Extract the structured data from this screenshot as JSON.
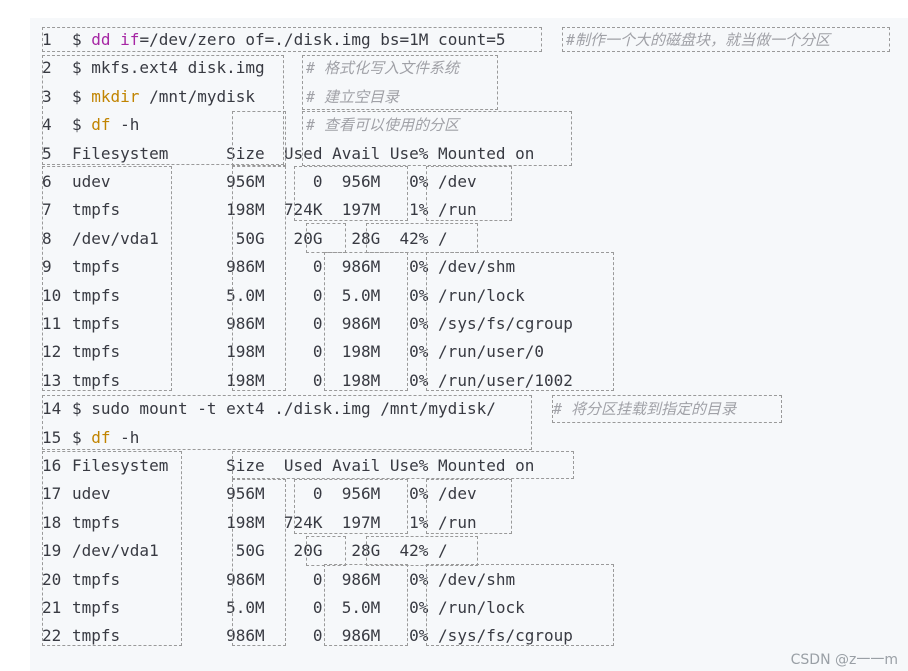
{
  "lines": [
    {
      "n": "1",
      "parts": [
        [
          "op",
          "$ "
        ],
        [
          "kw",
          "dd"
        ],
        [
          "op",
          " "
        ],
        [
          "kw",
          "if"
        ],
        [
          "op",
          "=/dev/zero of=./disk.img bs=1M count=5"
        ]
      ],
      "comment": "#制作一个大的磁盘块，就当做一个分区"
    },
    {
      "n": "2",
      "parts": [
        [
          "op",
          "$ mkfs.ext4 disk.img"
        ]
      ],
      "comment": "# 格式化写入文件系统"
    },
    {
      "n": "3",
      "parts": [
        [
          "op",
          "$ "
        ],
        [
          "fn",
          "mkdir"
        ],
        [
          "op",
          " /mnt/mydisk"
        ]
      ],
      "comment": "# 建立空目录"
    },
    {
      "n": "4",
      "parts": [
        [
          "op",
          "$ "
        ],
        [
          "fn",
          "df"
        ],
        [
          "op",
          " -h"
        ]
      ],
      "comment": "# 查看可以使用的分区"
    },
    {
      "n": "5",
      "parts": [
        [
          "op",
          "Filesystem      Size  Used Avail Use% Mounted on"
        ]
      ],
      "comment": ""
    },
    {
      "n": "6",
      "parts": [
        [
          "op",
          "udev            956M     0  956M   0% /dev"
        ]
      ],
      "comment": ""
    },
    {
      "n": "7",
      "parts": [
        [
          "op",
          "tmpfs           198M  724K  197M   1% /run"
        ]
      ],
      "comment": ""
    },
    {
      "n": "8",
      "parts": [
        [
          "op",
          "/dev/vda1        50G   20G   28G  42% /"
        ]
      ],
      "comment": ""
    },
    {
      "n": "9",
      "parts": [
        [
          "op",
          "tmpfs           986M     0  986M   0% /dev/shm"
        ]
      ],
      "comment": ""
    },
    {
      "n": "10",
      "parts": [
        [
          "op",
          "tmpfs           5.0M     0  5.0M   0% /run/lock"
        ]
      ],
      "comment": ""
    },
    {
      "n": "11",
      "parts": [
        [
          "op",
          "tmpfs           986M     0  986M   0% /sys/fs/cgroup"
        ]
      ],
      "comment": ""
    },
    {
      "n": "12",
      "parts": [
        [
          "op",
          "tmpfs           198M     0  198M   0% /run/user/0"
        ]
      ],
      "comment": ""
    },
    {
      "n": "13",
      "parts": [
        [
          "op",
          "tmpfs           198M     0  198M   0% /run/user/1002"
        ]
      ],
      "comment": ""
    },
    {
      "n": "14",
      "parts": [
        [
          "op",
          "$ sudo mount -t ext4 ./disk.img /mnt/mydisk/"
        ]
      ],
      "comment": "# 将分区挂载到指定的目录"
    },
    {
      "n": "15",
      "parts": [
        [
          "op",
          "$ "
        ],
        [
          "fn",
          "df"
        ],
        [
          "op",
          " -h"
        ]
      ],
      "comment": ""
    },
    {
      "n": "16",
      "parts": [
        [
          "op",
          "Filesystem      Size  Used Avail Use% Mounted on"
        ]
      ],
      "comment": ""
    },
    {
      "n": "17",
      "parts": [
        [
          "op",
          "udev            956M     0  956M   0% /dev"
        ]
      ],
      "comment": ""
    },
    {
      "n": "18",
      "parts": [
        [
          "op",
          "tmpfs           198M  724K  197M   1% /run"
        ]
      ],
      "comment": ""
    },
    {
      "n": "19",
      "parts": [
        [
          "op",
          "/dev/vda1        50G   20G   28G  42% /"
        ]
      ],
      "comment": ""
    },
    {
      "n": "20",
      "parts": [
        [
          "op",
          "tmpfs           986M     0  986M   0% /dev/shm"
        ]
      ],
      "comment": ""
    },
    {
      "n": "21",
      "parts": [
        [
          "op",
          "tmpfs           5.0M     0  5.0M   0% /run/lock"
        ]
      ],
      "comment": ""
    },
    {
      "n": "22",
      "parts": [
        [
          "op",
          "tmpfs           986M     0  986M   0% /sys/fs/cgroup"
        ]
      ],
      "comment": ""
    }
  ],
  "watermark": "CSDN @z一一m",
  "colors": {
    "keyword": "#a626a4",
    "builtin": "#c18401",
    "comment": "#a0a1a7",
    "text": "#383a42",
    "background": "#f6f8fa"
  }
}
